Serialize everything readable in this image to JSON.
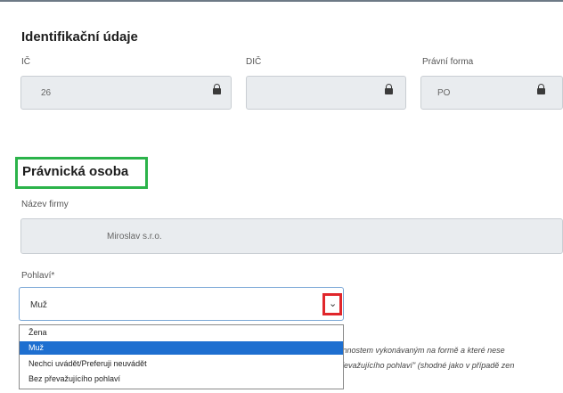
{
  "identification": {
    "title": "Identifikační údaje",
    "ico_label": "IČ",
    "ico_value": "26",
    "dic_label": "DIČ",
    "dic_value": "",
    "legal_form_label": "Právní forma",
    "legal_form_value": "PO"
  },
  "legal_person": {
    "title": "Právnická osoba",
    "company_label": "Název firmy",
    "company_value": "Miroslav s.r.o.",
    "gender_label": "Pohlaví*",
    "gender_value": "Muž",
    "gender_options": [
      "Žena",
      "Muž",
      "Nechci uvádět/Preferuji neuvádět",
      "Bez převažujícího pohlaví"
    ],
    "selected_option_index": 1
  },
  "background_text": {
    "line1": "činnostem vykonávaným na formě a které nese",
    "line2": "převažujícího pohlaví\" (shodné jako v případě zen"
  },
  "colors": {
    "highlight_green": "#2bb34a",
    "highlight_red": "#e0262b",
    "selected_option": "#1e6fd0"
  },
  "icons": [
    "lock-icon",
    "chevron-down-icon"
  ]
}
